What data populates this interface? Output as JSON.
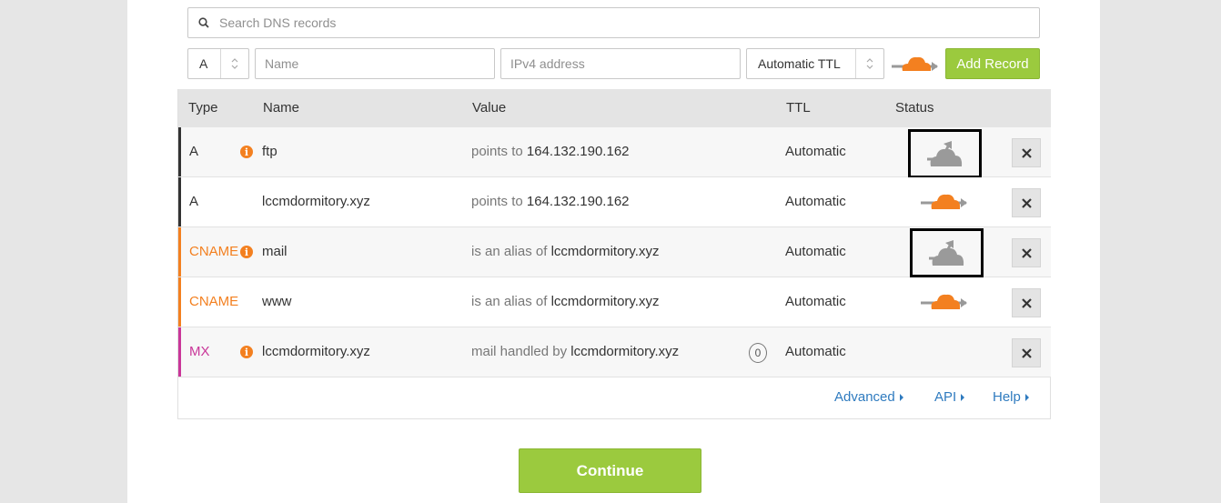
{
  "search": {
    "placeholder": "Search DNS records"
  },
  "add_form": {
    "type_value": "A",
    "name_placeholder": "Name",
    "value_placeholder": "IPv4 address",
    "ttl_value": "Automatic TTL",
    "add_button_label": "Add Record",
    "proxy_icon": "orange-cloud-icon"
  },
  "table": {
    "headers": {
      "type": "Type",
      "name": "Name",
      "value": "Value",
      "ttl": "TTL",
      "status": "Status"
    },
    "rows": [
      {
        "type": "A",
        "name": "ftp",
        "value_prefix": "points to",
        "value": "164.132.190.162",
        "ttl": "Automatic",
        "status": "dns-only",
        "info": true,
        "priority": ""
      },
      {
        "type": "A",
        "name": "lccmdormitory.xyz",
        "value_prefix": "points to",
        "value": "164.132.190.162",
        "ttl": "Automatic",
        "status": "proxied",
        "info": false,
        "priority": ""
      },
      {
        "type": "CNAME",
        "name": "mail",
        "value_prefix": "is an alias of",
        "value": "lccmdormitory.xyz",
        "ttl": "Automatic",
        "status": "dns-only",
        "info": true,
        "priority": ""
      },
      {
        "type": "CNAME",
        "name": "www",
        "value_prefix": "is an alias of",
        "value": "lccmdormitory.xyz",
        "ttl": "Automatic",
        "status": "proxied",
        "info": false,
        "priority": ""
      },
      {
        "type": "MX",
        "name": "lccmdormitory.xyz",
        "value_prefix": "mail handled by",
        "value": "lccmdormitory.xyz",
        "ttl": "Automatic",
        "status": "",
        "info": true,
        "priority": "0"
      }
    ],
    "delete_icon": "close-icon",
    "info_icon": "i"
  },
  "footer_links": {
    "advanced": "Advanced",
    "api": "API",
    "help": "Help"
  },
  "continue_label": "Continue",
  "colors": {
    "accent_green": "#9bca3e",
    "cloudflare_orange": "#f38020",
    "type_a": "#333333",
    "type_cname": "#f38020",
    "type_mx": "#c93699",
    "link": "#2f7bbf"
  }
}
